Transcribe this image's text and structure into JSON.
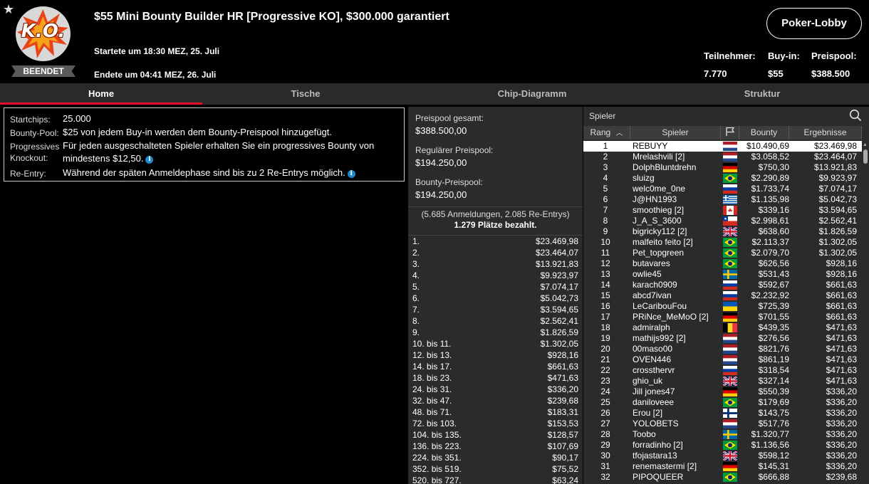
{
  "header": {
    "title": "$55 Mini Bounty Builder HR [Progressive KO], $300.000 garantiert",
    "logo_text": "K.O.",
    "status": "BEENDET",
    "start_time": "Startete um 18:30 MEZ, 25. Juli",
    "end_time": "Endete um 04:41 MEZ, 26. Juli",
    "lobby_button": "Poker-Lobby",
    "stats": [
      {
        "label": "Teilnehmer:",
        "value": "7.770"
      },
      {
        "label": "Buy-in:",
        "value": "$55"
      },
      {
        "label": "Preispool:",
        "value": "$388.500"
      }
    ]
  },
  "tabs": [
    "Home",
    "Tische",
    "Chip-Diagramm",
    "Struktur"
  ],
  "info": {
    "startchips_label": "Startchips:",
    "startchips_value": "25.000",
    "bountypool_label": "Bounty-Pool:",
    "bountypool_value": "$25 von jedem Buy-in werden dem Bounty-Preispool hinzugefügt.",
    "progressive_label_1": "Progressives",
    "progressive_label_2": "Knockout:",
    "progressive_value": "Für jeden ausgeschalteten Spieler erhalten Sie ein progressives Bounty von mindestens $12,50.",
    "reentry_label": "Re-Entry:",
    "reentry_value": "Während der späten Anmeldephase sind bis zu 2 Re-Entrys möglich."
  },
  "pool": {
    "total_label": "Preispool gesamt:",
    "total_value": "$388.500,00",
    "regular_label": "Regulärer Preispool:",
    "regular_value": "$194.250,00",
    "bounty_label": "Bounty-Preispool:",
    "bounty_value": "$194.250,00",
    "registrations": "(5.685 Anmeldungen, 2.085 Re-Entrys)",
    "paid_places": "1.279 Plätze bezahlt."
  },
  "payouts": [
    [
      "1.",
      "$23.469,98"
    ],
    [
      "2.",
      "$23.464,07"
    ],
    [
      "3.",
      "$13.921,83"
    ],
    [
      "4.",
      "$9.923,97"
    ],
    [
      "5.",
      "$7.074,17"
    ],
    [
      "6.",
      "$5.042,73"
    ],
    [
      "7.",
      "$3.594,65"
    ],
    [
      "8.",
      "$2.562,41"
    ],
    [
      "9.",
      "$1.826,59"
    ],
    [
      "10. bis 11.",
      "$1.302,05"
    ],
    [
      "12. bis 13.",
      "$928,16"
    ],
    [
      "14. bis 17.",
      "$661,63"
    ],
    [
      "18. bis 23.",
      "$471,63"
    ],
    [
      "24. bis 31.",
      "$336,20"
    ],
    [
      "32. bis 47.",
      "$239,68"
    ],
    [
      "48. bis 71.",
      "$183,31"
    ],
    [
      "72. bis 103.",
      "$153,53"
    ],
    [
      "104. bis 135.",
      "$128,57"
    ],
    [
      "136. bis 223.",
      "$107,69"
    ],
    [
      "224. bis 351.",
      "$90,17"
    ],
    [
      "352. bis 519.",
      "$75,52"
    ],
    [
      "520. bis 727.",
      "$63,24"
    ]
  ],
  "players": {
    "search_placeholder": "Spieler",
    "columns": {
      "rank": "Rang",
      "player": "Spieler",
      "bounty": "Bounty",
      "result": "Ergebnisse"
    },
    "rows": [
      {
        "rank": "1",
        "name": "REBUYY",
        "flag": "nl",
        "bounty": "$10.490,69",
        "result": "$23.469,98"
      },
      {
        "rank": "2",
        "name": "Mrelashvili [2]",
        "flag": "nl",
        "bounty": "$3.058,52",
        "result": "$23.464,07"
      },
      {
        "rank": "3",
        "name": "DolphBluntdrehn",
        "flag": "de",
        "bounty": "$750,30",
        "result": "$13.921,83"
      },
      {
        "rank": "4",
        "name": "sluizg",
        "flag": "br",
        "bounty": "$2.290,89",
        "result": "$9.923,97"
      },
      {
        "rank": "5",
        "name": "welc0me_0ne",
        "flag": "ru",
        "bounty": "$1.733,74",
        "result": "$7.074,17"
      },
      {
        "rank": "6",
        "name": "J@HN1993",
        "flag": "gr",
        "bounty": "$1.135,98",
        "result": "$5.042,73"
      },
      {
        "rank": "7",
        "name": "smoothieg [2]",
        "flag": "ca",
        "bounty": "$339,16",
        "result": "$3.594,65"
      },
      {
        "rank": "8",
        "name": "J_A_S_3600",
        "flag": "cl",
        "bounty": "$2.998,61",
        "result": "$2.562,41"
      },
      {
        "rank": "9",
        "name": "bigricky112 [2]",
        "flag": "gb",
        "bounty": "$638,60",
        "result": "$1.826,59"
      },
      {
        "rank": "10",
        "name": "malfeito feito [2]",
        "flag": "br",
        "bounty": "$2.113,37",
        "result": "$1.302,05"
      },
      {
        "rank": "11",
        "name": "Pet_topgreen",
        "flag": "br",
        "bounty": "$2.079,70",
        "result": "$1.302,05"
      },
      {
        "rank": "12",
        "name": "butavares",
        "flag": "br",
        "bounty": "$626,56",
        "result": "$928,16"
      },
      {
        "rank": "13",
        "name": "owlie45",
        "flag": "se",
        "bounty": "$531,43",
        "result": "$928,16"
      },
      {
        "rank": "14",
        "name": "karach0909",
        "flag": "ru",
        "bounty": "$592,67",
        "result": "$661,63"
      },
      {
        "rank": "15",
        "name": "abcd7ivan",
        "flag": "ru",
        "bounty": "$2.232,92",
        "result": "$661,63"
      },
      {
        "rank": "16",
        "name": "LeCaribouFou",
        "flag": "ua",
        "bounty": "$725,39",
        "result": "$661,63"
      },
      {
        "rank": "17",
        "name": "PRiNce_MeMoO [2]",
        "flag": "de",
        "bounty": "$701,55",
        "result": "$661,63"
      },
      {
        "rank": "18",
        "name": "admiralph",
        "flag": "be",
        "bounty": "$439,35",
        "result": "$471,63"
      },
      {
        "rank": "19",
        "name": "mathijs992 [2]",
        "flag": "nl",
        "bounty": "$276,56",
        "result": "$471,63"
      },
      {
        "rank": "20",
        "name": "00maso00",
        "flag": "nl",
        "bounty": "$821,76",
        "result": "$471,63"
      },
      {
        "rank": "21",
        "name": "OVEN446",
        "flag": "nl",
        "bounty": "$861,19",
        "result": "$471,63"
      },
      {
        "rank": "22",
        "name": "crossthervr",
        "flag": "ru",
        "bounty": "$318,54",
        "result": "$471,63"
      },
      {
        "rank": "23",
        "name": "ghio_uk",
        "flag": "gb",
        "bounty": "$327,14",
        "result": "$471,63"
      },
      {
        "rank": "24",
        "name": "Jill jones47",
        "flag": "de",
        "bounty": "$550,39",
        "result": "$336,20"
      },
      {
        "rank": "25",
        "name": "daniloveee",
        "flag": "br",
        "bounty": "$179,69",
        "result": "$336,20"
      },
      {
        "rank": "26",
        "name": "Erou [2]",
        "flag": "fi",
        "bounty": "$143,75",
        "result": "$336,20"
      },
      {
        "rank": "27",
        "name": "YOLOBETS",
        "flag": "nl",
        "bounty": "$517,76",
        "result": "$336,20"
      },
      {
        "rank": "28",
        "name": "Toobo",
        "flag": "se",
        "bounty": "$1.320,77",
        "result": "$336,20"
      },
      {
        "rank": "29",
        "name": "forradinho [2]",
        "flag": "br",
        "bounty": "$1.136,56",
        "result": "$336,20"
      },
      {
        "rank": "30",
        "name": "tfojastara13",
        "flag": "gb",
        "bounty": "$598,12",
        "result": "$336,20"
      },
      {
        "rank": "31",
        "name": "renemastermi [2]",
        "flag": "de",
        "bounty": "$145,31",
        "result": "$336,20"
      },
      {
        "rank": "32",
        "name": "PIPOQUEER",
        "flag": "br",
        "bounty": "$666,88",
        "result": "$239,68"
      }
    ]
  },
  "colors": {
    "accent": "#e0102a",
    "panel": "#2b2b2b",
    "header_bg": "#3c3c3c",
    "info_icon": "#1e88c8"
  }
}
